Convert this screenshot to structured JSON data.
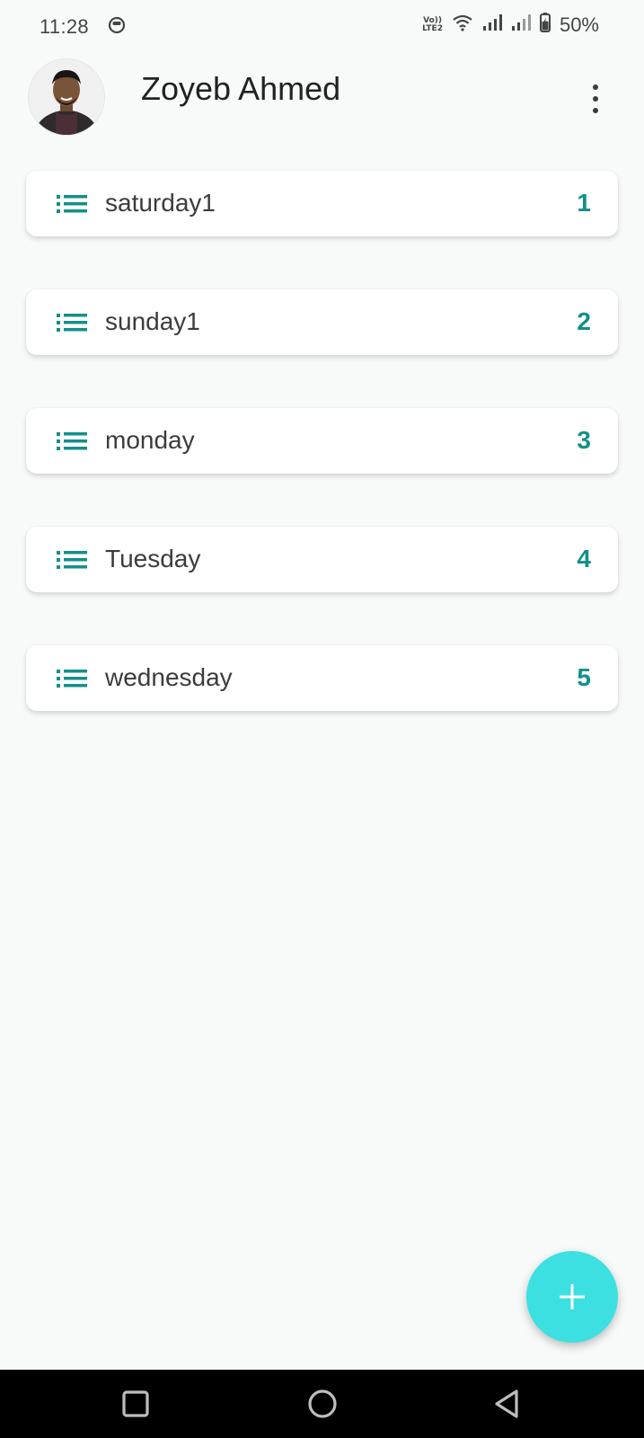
{
  "status_bar": {
    "time": "11:28",
    "network_label_top": "Vo))",
    "network_label_bottom": "LTE2",
    "battery": "50%"
  },
  "header": {
    "user_name": "Zoyeb Ahmed"
  },
  "lists": [
    {
      "label": "saturday1",
      "count": "1"
    },
    {
      "label": "sunday1",
      "count": "2"
    },
    {
      "label": "monday",
      "count": "3"
    },
    {
      "label": "Tuesday",
      "count": "4"
    },
    {
      "label": "wednesday",
      "count": "5"
    }
  ],
  "fab": {
    "icon": "plus-icon"
  },
  "colors": {
    "accent": "#138f8a",
    "fab": "#3ce0e0",
    "background": "#f8fafa"
  },
  "nav": {
    "recents_icon": "square-icon",
    "home_icon": "circle-icon",
    "back_icon": "triangle-back-icon"
  }
}
